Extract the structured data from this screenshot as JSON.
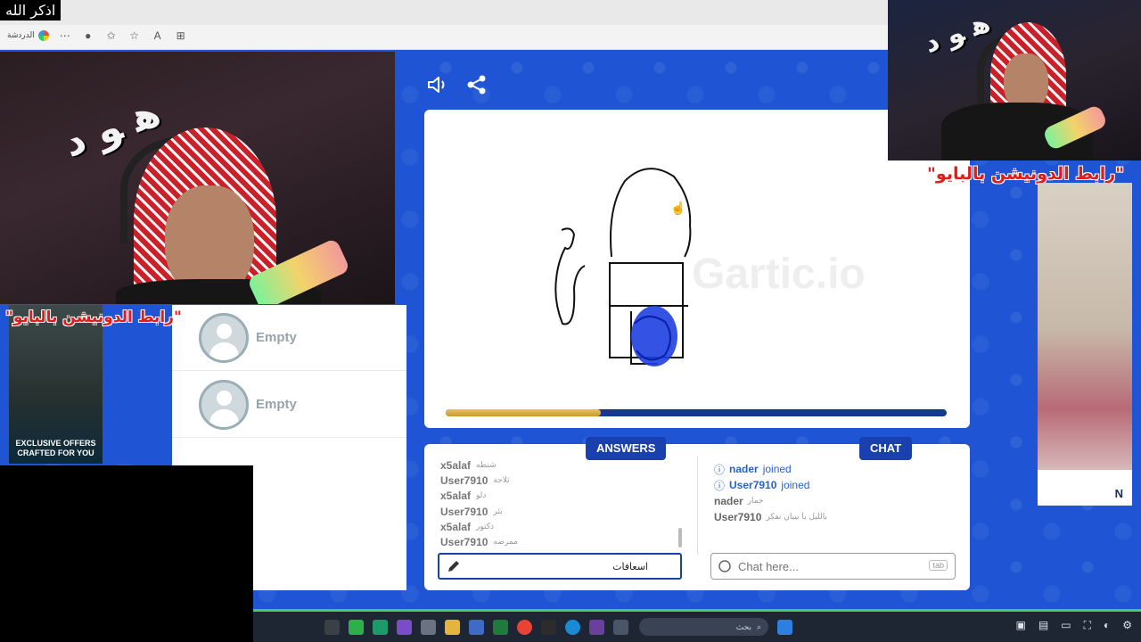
{
  "browser": {
    "bookmark_label": "الدردشة",
    "toolbar_icons": [
      "more-icon",
      "profile-icon",
      "favorites-icon",
      "star-icon",
      "read-aloud-icon",
      "collections-icon"
    ]
  },
  "overlay": {
    "corner_text": "اذكر الله",
    "donation_top": "\"رابط الدونيشن بالبايو\"",
    "donation_left": "\"رابط الدونيشن بالبايو\""
  },
  "ads": {
    "left_text": "EXCLUSIVE OFFERS CRAFTED FOR YOU",
    "right_logo": "N"
  },
  "game": {
    "progress": 0.31,
    "watermark": "Gartic.io",
    "players": [
      {
        "name": "Empty"
      },
      {
        "name": "Empty"
      }
    ],
    "answers_tab": "ANSWERS",
    "chat_tab": "CHAT",
    "answers": [
      {
        "user": "x5alaf",
        "word": "شنطه"
      },
      {
        "user": "User7910",
        "word": "ثلاجة"
      },
      {
        "user": "x5alaf",
        "word": "دلو"
      },
      {
        "user": "User7910",
        "word": "بئر"
      },
      {
        "user": "x5alaf",
        "word": "دكتور"
      },
      {
        "user": "User7910",
        "word": "ممرضه"
      }
    ],
    "answer_input_value": "اسعافات",
    "chat": {
      "joins": [
        {
          "user": "nader",
          "text": "joined"
        },
        {
          "user": "User7910",
          "text": "joined"
        }
      ],
      "messages": [
        {
          "user": "nader",
          "text": "حمار"
        },
        {
          "user": "User7910",
          "text": "بالليل يا بيبان نفكر"
        }
      ],
      "placeholder": "Chat here...",
      "tab_hint": "tab"
    }
  },
  "taskbar": {
    "search_label": "بحث"
  },
  "colors": {
    "game_blue": "#1f55d4",
    "tab_blue": "#1a3fae",
    "progress_gold": "#d9ad44",
    "progress_track": "#123a8a"
  }
}
